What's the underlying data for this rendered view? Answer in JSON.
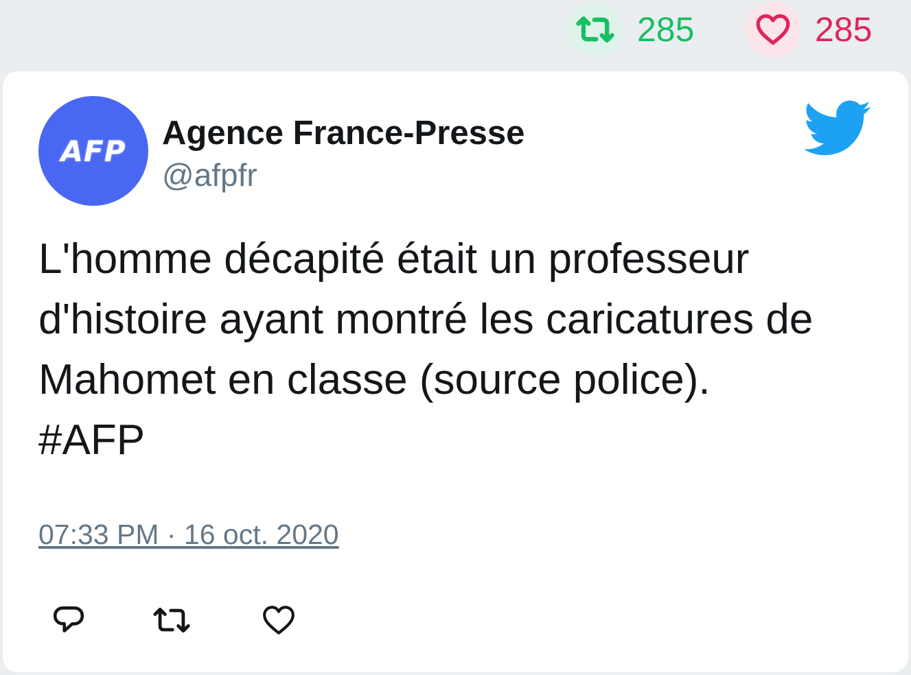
{
  "stats": {
    "retweets": "285",
    "likes": "285"
  },
  "author": {
    "avatar_text": "AFP",
    "display_name": "Agence France-Presse",
    "handle": "@afpfr"
  },
  "tweet": {
    "text": "L'homme décapité était un professeur\nd'histoire ayant montré les caricatures de\nMahomet en classe (source police).\n#AFP",
    "timestamp": "07:33 PM · 16 oct. 2020"
  },
  "icons": {
    "retweet": "retweet-icon",
    "like": "heart-icon",
    "reply": "reply-icon",
    "brand": "twitter-bird-icon"
  },
  "colors": {
    "retweet": "#17bf63",
    "like": "#e0245e",
    "brand": "#1da1f2",
    "avatar": "#4967f2",
    "muted": "#657786"
  }
}
